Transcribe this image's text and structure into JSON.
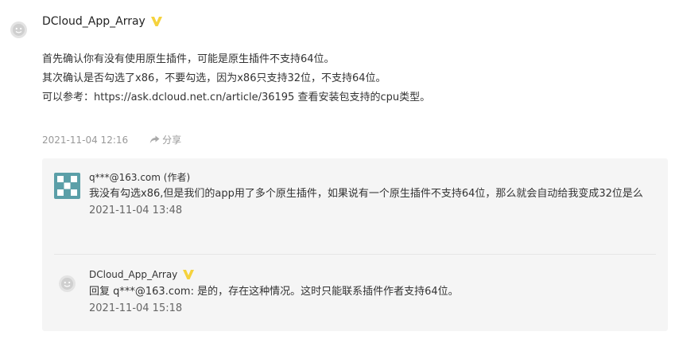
{
  "comment": {
    "username": "DCloud_App_Array",
    "lines": [
      "首先确认你有没有使用原生插件，可能是原生插件不支持64位。",
      "其次确认是否勾选了x86，不要勾选，因为x86只支持32位，不支持64位。",
      "可以参考：https://ask.dcloud.net.cn/article/36195 查看安装包支持的cpu类型。"
    ],
    "timestamp": "2021-11-04 12:16",
    "share_label": "分享"
  },
  "replies": [
    {
      "author": "q***@163.com (作者)",
      "text": "我没有勾选x86,但是我们的app用了多个原生插件，如果说有一个原生插件不支持64位，那么就会自动给我变成32位是么",
      "time": "2021-11-04 13:48"
    },
    {
      "author": "DCloud_App_Array",
      "text": "回复 q***@163.com: 是的，存在这种情况。这时只能联系插件作者支持64位。",
      "time": "2021-11-04 15:18"
    }
  ],
  "colors": {
    "vip_badge": "#f5d23d",
    "reply_avatar": "#5b9fa8",
    "reply_bg": "#f5f5f5"
  }
}
